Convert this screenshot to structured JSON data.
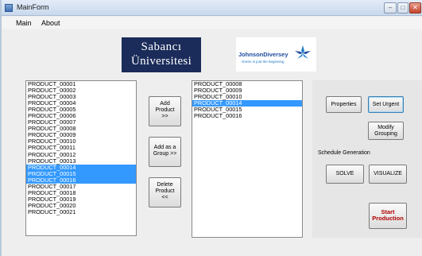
{
  "window": {
    "title": "MainForm",
    "controls": {
      "minimize": "–",
      "maximize": "□",
      "close": "✕"
    }
  },
  "menu": {
    "items": [
      "Main",
      "About"
    ]
  },
  "logos": {
    "sabanci": {
      "line1": "Sabancı",
      "line2": "Üniversitesi",
      "color": "#1b2c5a"
    },
    "johnson": {
      "name": "JohnsonDiversey",
      "tagline": "Green is just the beginning",
      "color": "#1f4a9e"
    }
  },
  "available_products": {
    "items": [
      "PRODUCT_00001",
      "PRODUCT_00002",
      "PRODUCT_00003",
      "PRODUCT_00004",
      "PRODUCT_00005",
      "PRODUCT_00006",
      "PRODUCT_00007",
      "PRODUCT_00008",
      "PRODUCT_00009",
      "PRODUCT_00010",
      "PRODUCT_00011",
      "PRODUCT_00012",
      "PRODUCT_00013",
      "PRODUCT_00014",
      "PRODUCT_00015",
      "PRODUCT_00016",
      "PRODUCT_00017",
      "PRODUCT_00018",
      "PRODUCT_00019",
      "PRODUCT_00020",
      "PRODUCT_00021"
    ],
    "selected": [
      "PRODUCT_00014",
      "PRODUCT_00015",
      "PRODUCT_00016"
    ]
  },
  "selected_products": {
    "items": [
      "PRODUCT_00008",
      "PRODUCT_00009",
      "PRODUCT_00010",
      "PRODUCT_00014",
      "PRODUCT_00015",
      "PRODUCT_00016"
    ],
    "selected": [
      "PRODUCT_00014"
    ]
  },
  "buttons": {
    "add_product": [
      "Add",
      "Product",
      ">>"
    ],
    "add_group": [
      "Add as a",
      "Group >>"
    ],
    "delete_product": [
      "Delete",
      "Product",
      "<<"
    ],
    "properties": "Properties",
    "set_urgent": "Set Urgent",
    "modify_grouping": [
      "Modify",
      "Grouping"
    ],
    "solve": "SOLVE",
    "visualize": "VISUALIZE",
    "start_production": [
      "Start",
      "Production"
    ]
  },
  "schedule_generation_label": "Schedule Generation",
  "colors": {
    "selection": "#3399ff",
    "start_production_text": "#b00000"
  }
}
